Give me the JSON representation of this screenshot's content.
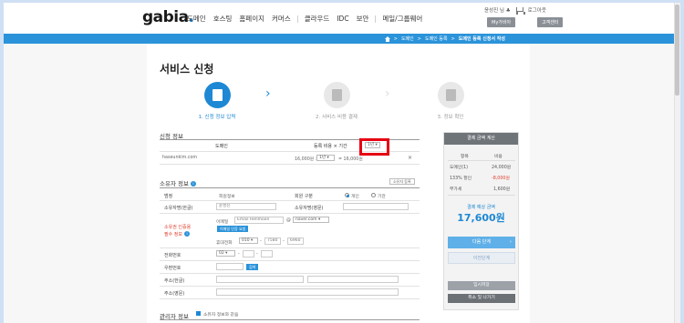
{
  "header": {
    "logo": "gabia",
    "logo_dot": ".",
    "nav": [
      "도메인",
      "호스팅",
      "홈페이지",
      "커머스",
      "클라우드",
      "IDC",
      "보안",
      "메일/그룹웨어"
    ],
    "user_greeting": "윤성진 님 ♣",
    "logout": "로그아웃",
    "my_gabia": "My가비아",
    "customer_center": "고객센터"
  },
  "breadcrumb": {
    "items": [
      "도메인",
      "도메인 등록"
    ],
    "current": "도메인 등록 신청서 작성",
    "sep": ">"
  },
  "page_title": "서비스 신청",
  "steps": [
    {
      "label": "1. 신청 정보 입력",
      "active": true
    },
    {
      "label": "2. 서비스 비용 결제",
      "active": false
    },
    {
      "label": "3. 정보 확인",
      "active": false
    }
  ],
  "step_arrow": "›",
  "apply_info": {
    "title": "신청 정보",
    "col_domain": "도메인",
    "col_fee": "등록 비용 × 기간",
    "period_select": "1년",
    "row_domain": "haseunkim.com",
    "row_price": "16,000원 ×",
    "row_period": "1년",
    "row_total": "= 16,000원",
    "remove": "×"
  },
  "owner_info": {
    "title": "소유자 정보",
    "info_mark": "i",
    "load_button": "소유자 등록",
    "label_kind": "범정",
    "value_kind": "회원정보",
    "label_type": "회원 구분",
    "radio_personal": "개인",
    "radio_other": "기관",
    "label_name_kr": "소유자명(한글)",
    "value_name_kr": "윤성진",
    "label_name_en": "소유자명(영문)",
    "label_required": "소유권 인증용",
    "label_required2": "필수 정보",
    "email_label": "이메일",
    "email_id": "Email Hellmoon",
    "email_at": "@",
    "email_domain": "naver.com",
    "email_verify": "이메일 인증 요청",
    "phone_label": "휴대전화",
    "phone_1": "010",
    "phone_2": "7580",
    "phone_3": "6960",
    "phone_dash": "-",
    "label_phone": "전화번호",
    "phone_area": "02",
    "label_zip": "우편번호",
    "zip_button": "검색",
    "label_addr_kr": "주소(한글)",
    "label_addr_en": "주소(영문)"
  },
  "admin_info": {
    "title": "관리자 정보",
    "same_as_owner": "소유자 정보와 같음"
  },
  "summary": {
    "title": "결제 금액 계산",
    "col_item": "항목",
    "col_cost": "비용",
    "rows": [
      {
        "item": "도메인(1)",
        "cost": "24,000원"
      },
      {
        "item": "133% 할인",
        "cost": "-8,000원"
      },
      {
        "item": "부가세",
        "cost": "1,600원"
      }
    ],
    "total_label": "결제 예상 금액",
    "total_price": "17,600원",
    "btn_next": "다음 단계",
    "btn_next_alt": "이전단계",
    "btn_save": "임시저장",
    "btn_cancel": "취소 및 나가기",
    "chevron": "›"
  }
}
